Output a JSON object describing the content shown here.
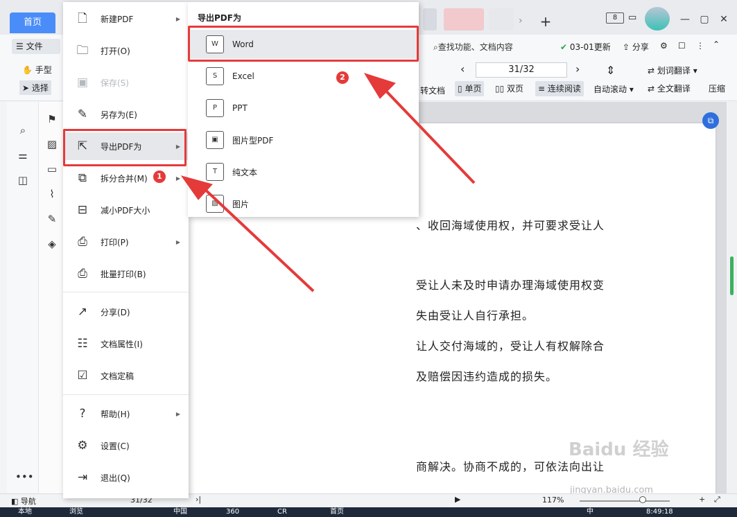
{
  "titlebar": {
    "home_tab": "首页",
    "count_badge": "8"
  },
  "ribbon": {
    "file_label": "文件",
    "hand_tool": "手型",
    "select_tool": "选择",
    "search_placeholder": "查找功能、文档内容",
    "update_label": "03-01更新",
    "share_label": "分享",
    "convert_label": "转文档",
    "page_indicator": "31/32",
    "single_page": "单页",
    "double_page": "双页",
    "continuous": "连续阅读",
    "auto_scroll": "自动滚动",
    "word_translate": "划词翻译",
    "full_translate": "全文翻译",
    "compress": "压缩"
  },
  "file_menu": {
    "items": [
      {
        "label": "新建PDF",
        "icon": "new-file-icon",
        "arrow": true
      },
      {
        "label": "打开(O)",
        "icon": "folder-open-icon",
        "arrow": false
      },
      {
        "label": "保存(S)",
        "icon": "save-icon",
        "arrow": false,
        "disabled": true
      },
      {
        "label": "另存为(E)",
        "icon": "save-as-icon",
        "arrow": false
      },
      {
        "label": "导出PDF为",
        "icon": "export-pdf-icon",
        "arrow": true,
        "highlighted": true
      },
      {
        "label": "拆分合并(M)",
        "icon": "split-merge-icon",
        "arrow": true
      },
      {
        "label": "减小PDF大小",
        "icon": "compress-icon",
        "arrow": false
      },
      {
        "label": "打印(P)",
        "icon": "print-icon",
        "arrow": true
      },
      {
        "label": "批量打印(B)",
        "icon": "batch-print-icon",
        "arrow": false
      },
      {
        "label": "分享(D)",
        "icon": "share-icon",
        "arrow": false
      },
      {
        "label": "文档属性(I)",
        "icon": "doc-properties-icon",
        "arrow": false
      },
      {
        "label": "文档定稿",
        "icon": "finalize-icon",
        "arrow": false
      },
      {
        "label": "帮助(H)",
        "icon": "help-icon",
        "arrow": true
      },
      {
        "label": "设置(C)",
        "icon": "settings-icon",
        "arrow": false
      },
      {
        "label": "退出(Q)",
        "icon": "exit-icon",
        "arrow": false
      }
    ]
  },
  "submenu": {
    "title": "导出PDF为",
    "items": [
      {
        "label": "Word",
        "glyph": "W",
        "highlighted": true
      },
      {
        "label": "Excel",
        "glyph": "S"
      },
      {
        "label": "PPT",
        "glyph": "P"
      },
      {
        "label": "图片型PDF",
        "glyph": "▣"
      },
      {
        "label": "纯文本",
        "glyph": "T"
      },
      {
        "label": "图片",
        "glyph": "▧"
      }
    ]
  },
  "annotations": {
    "step1": "1",
    "step2": "2",
    "accent": "#e53a3a"
  },
  "document": {
    "lines": [
      "、收回海域使用权，并可要求受让人",
      "受让人未及时申请办理海域使用权变",
      "失由受让人自行承担。",
      "让人交付海域的，受让人有权解除合",
      "及赔偿因违约造成的损失。",
      "商解决。协商不成的，可依法向出让"
    ]
  },
  "statusbar": {
    "nav_label": "导航",
    "page": "31/32",
    "zoom": "117%"
  },
  "taskbar": {
    "time": "8:49:18",
    "items": [
      "本地",
      "浏览",
      "",
      "中国",
      "360",
      "CR",
      "首页",
      "",
      "",
      "",
      "中"
    ]
  },
  "watermark": {
    "text": "Baidu 经验",
    "url": "jingyan.baidu.com"
  },
  "colors": {
    "home_tab": "#4a8df8",
    "scroll_thumb": "#3db062",
    "annotation": "#e53a3a"
  }
}
